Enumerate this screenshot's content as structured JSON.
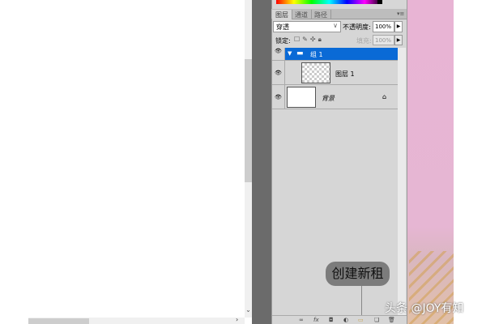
{
  "panel": {
    "tabs": [
      "图层",
      "通道",
      "路径"
    ],
    "blend_mode": "穿透",
    "opacity_label": "不透明度:",
    "opacity_value": "100%",
    "lock_label": "锁定:",
    "fill_label": "填充:",
    "fill_value": "100%",
    "layers": [
      {
        "name": "组 1",
        "type": "group",
        "selected": true
      },
      {
        "name": "图层 1",
        "type": "layer"
      },
      {
        "name": "背景",
        "type": "background",
        "locked": true
      }
    ],
    "tooltip": "创建新租"
  },
  "watermark": "头条 @JOY有知",
  "colors": {
    "selection": "#0a6ad6",
    "panel": "#d6d6d6"
  }
}
